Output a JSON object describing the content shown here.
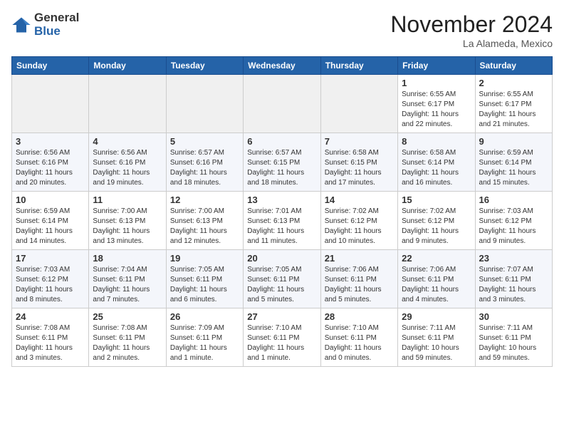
{
  "logo": {
    "general": "General",
    "blue": "Blue"
  },
  "title": "November 2024",
  "location": "La Alameda, Mexico",
  "headers": [
    "Sunday",
    "Monday",
    "Tuesday",
    "Wednesday",
    "Thursday",
    "Friday",
    "Saturday"
  ],
  "weeks": [
    [
      {
        "day": "",
        "info": ""
      },
      {
        "day": "",
        "info": ""
      },
      {
        "day": "",
        "info": ""
      },
      {
        "day": "",
        "info": ""
      },
      {
        "day": "",
        "info": ""
      },
      {
        "day": "1",
        "info": "Sunrise: 6:55 AM\nSunset: 6:17 PM\nDaylight: 11 hours\nand 22 minutes."
      },
      {
        "day": "2",
        "info": "Sunrise: 6:55 AM\nSunset: 6:17 PM\nDaylight: 11 hours\nand 21 minutes."
      }
    ],
    [
      {
        "day": "3",
        "info": "Sunrise: 6:56 AM\nSunset: 6:16 PM\nDaylight: 11 hours\nand 20 minutes."
      },
      {
        "day": "4",
        "info": "Sunrise: 6:56 AM\nSunset: 6:16 PM\nDaylight: 11 hours\nand 19 minutes."
      },
      {
        "day": "5",
        "info": "Sunrise: 6:57 AM\nSunset: 6:16 PM\nDaylight: 11 hours\nand 18 minutes."
      },
      {
        "day": "6",
        "info": "Sunrise: 6:57 AM\nSunset: 6:15 PM\nDaylight: 11 hours\nand 18 minutes."
      },
      {
        "day": "7",
        "info": "Sunrise: 6:58 AM\nSunset: 6:15 PM\nDaylight: 11 hours\nand 17 minutes."
      },
      {
        "day": "8",
        "info": "Sunrise: 6:58 AM\nSunset: 6:14 PM\nDaylight: 11 hours\nand 16 minutes."
      },
      {
        "day": "9",
        "info": "Sunrise: 6:59 AM\nSunset: 6:14 PM\nDaylight: 11 hours\nand 15 minutes."
      }
    ],
    [
      {
        "day": "10",
        "info": "Sunrise: 6:59 AM\nSunset: 6:14 PM\nDaylight: 11 hours\nand 14 minutes."
      },
      {
        "day": "11",
        "info": "Sunrise: 7:00 AM\nSunset: 6:13 PM\nDaylight: 11 hours\nand 13 minutes."
      },
      {
        "day": "12",
        "info": "Sunrise: 7:00 AM\nSunset: 6:13 PM\nDaylight: 11 hours\nand 12 minutes."
      },
      {
        "day": "13",
        "info": "Sunrise: 7:01 AM\nSunset: 6:13 PM\nDaylight: 11 hours\nand 11 minutes."
      },
      {
        "day": "14",
        "info": "Sunrise: 7:02 AM\nSunset: 6:12 PM\nDaylight: 11 hours\nand 10 minutes."
      },
      {
        "day": "15",
        "info": "Sunrise: 7:02 AM\nSunset: 6:12 PM\nDaylight: 11 hours\nand 9 minutes."
      },
      {
        "day": "16",
        "info": "Sunrise: 7:03 AM\nSunset: 6:12 PM\nDaylight: 11 hours\nand 9 minutes."
      }
    ],
    [
      {
        "day": "17",
        "info": "Sunrise: 7:03 AM\nSunset: 6:12 PM\nDaylight: 11 hours\nand 8 minutes."
      },
      {
        "day": "18",
        "info": "Sunrise: 7:04 AM\nSunset: 6:11 PM\nDaylight: 11 hours\nand 7 minutes."
      },
      {
        "day": "19",
        "info": "Sunrise: 7:05 AM\nSunset: 6:11 PM\nDaylight: 11 hours\nand 6 minutes."
      },
      {
        "day": "20",
        "info": "Sunrise: 7:05 AM\nSunset: 6:11 PM\nDaylight: 11 hours\nand 5 minutes."
      },
      {
        "day": "21",
        "info": "Sunrise: 7:06 AM\nSunset: 6:11 PM\nDaylight: 11 hours\nand 5 minutes."
      },
      {
        "day": "22",
        "info": "Sunrise: 7:06 AM\nSunset: 6:11 PM\nDaylight: 11 hours\nand 4 minutes."
      },
      {
        "day": "23",
        "info": "Sunrise: 7:07 AM\nSunset: 6:11 PM\nDaylight: 11 hours\nand 3 minutes."
      }
    ],
    [
      {
        "day": "24",
        "info": "Sunrise: 7:08 AM\nSunset: 6:11 PM\nDaylight: 11 hours\nand 3 minutes."
      },
      {
        "day": "25",
        "info": "Sunrise: 7:08 AM\nSunset: 6:11 PM\nDaylight: 11 hours\nand 2 minutes."
      },
      {
        "day": "26",
        "info": "Sunrise: 7:09 AM\nSunset: 6:11 PM\nDaylight: 11 hours\nand 1 minute."
      },
      {
        "day": "27",
        "info": "Sunrise: 7:10 AM\nSunset: 6:11 PM\nDaylight: 11 hours\nand 1 minute."
      },
      {
        "day": "28",
        "info": "Sunrise: 7:10 AM\nSunset: 6:11 PM\nDaylight: 11 hours\nand 0 minutes."
      },
      {
        "day": "29",
        "info": "Sunrise: 7:11 AM\nSunset: 6:11 PM\nDaylight: 10 hours\nand 59 minutes."
      },
      {
        "day": "30",
        "info": "Sunrise: 7:11 AM\nSunset: 6:11 PM\nDaylight: 10 hours\nand 59 minutes."
      }
    ]
  ]
}
